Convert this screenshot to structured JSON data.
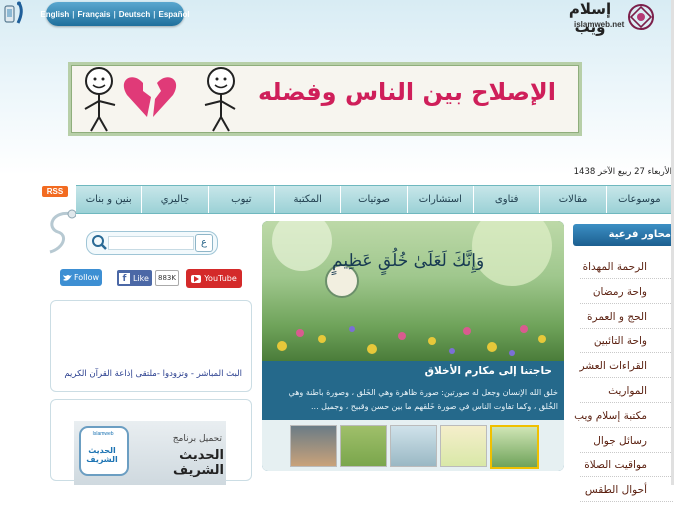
{
  "languages": [
    "English",
    "Français",
    "Deutsch",
    "Español"
  ],
  "logo": {
    "arabic": "إسلام ويب",
    "latin": "islamweb.net"
  },
  "banner": {
    "title": "الإصلاح بين الناس وفضله"
  },
  "date": "الأربعاء 27 ربيع الآخر 1438",
  "rss_label": "RSS",
  "nav": [
    "موسوعات",
    "مقالات",
    "فتاوى",
    "استشارات",
    "صوتيات",
    "المكتبة",
    "تيوب",
    "جاليري",
    "بنين و بنات"
  ],
  "sidebar": {
    "heading": "محاور فرعية",
    "items": [
      "الرحمة المهداة",
      "واحة رمضان",
      "الحج و العمرة",
      "واحة التائبين",
      "القراءات العشر",
      "المواريث",
      "مكتبة إسلام ويب",
      "رسائل جوال",
      "مواقيت الصلاة",
      "أحوال الطقس"
    ]
  },
  "featured": {
    "calligraphy": "وَإِنَّكَ لَعَلَىٰ خُلُقٍ عَظِيمٍ",
    "title": "حاجتنا إلى مكارم الأخلاق",
    "text": "خلق الله الإنسان وجعل له صورتين: صورة ظاهرة وهي الخَلق ، وصورة باطنة وهي الخُلق ، وكما تفاوت الناس في صورة خَلقهم ما بين حسن وقبيح ، وجميل ..."
  },
  "social": {
    "twitter": "Follow",
    "facebook": "Like",
    "facebook_count": "883K",
    "youtube": "YouTube"
  },
  "radio_text": "البث المباشر - وتزودوا -ملتقى إذاعة القرآن الكريم",
  "app": {
    "title": "تحميل برنامج",
    "name": "الحديث الشريف",
    "icon_label": "الحديث الشريف",
    "icon_small": "Islamweb"
  },
  "colors": {
    "nav": "#9bd1d6",
    "banner_text": "#cf1f5a",
    "sidebar_head": "#2a7bb0",
    "feature_bg": "#25698b"
  }
}
